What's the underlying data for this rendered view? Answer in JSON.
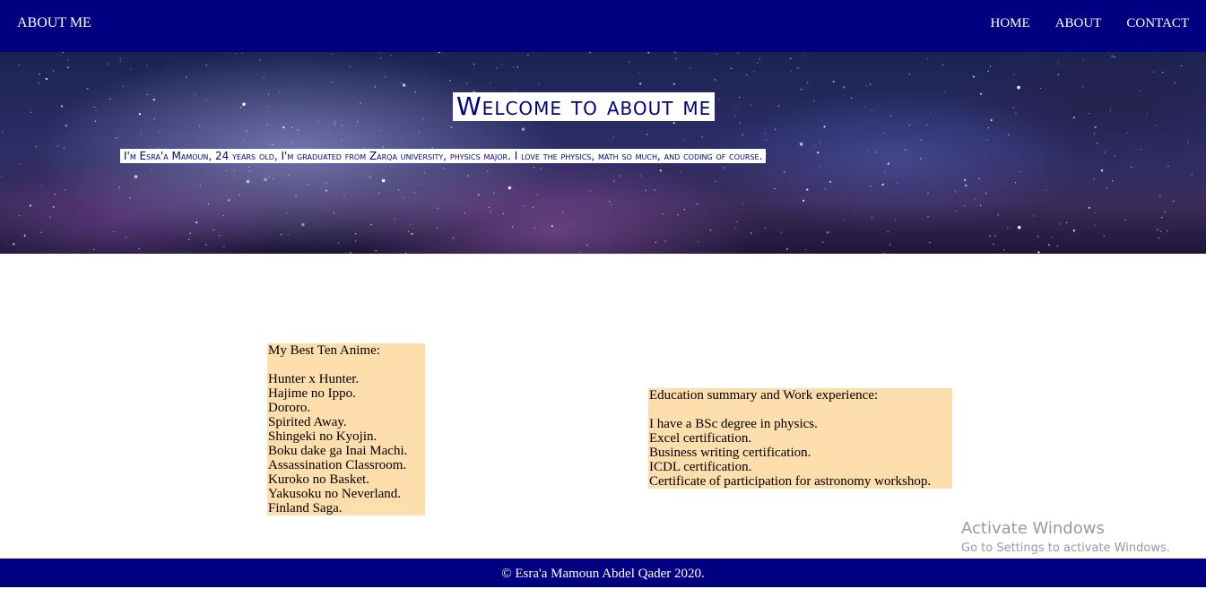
{
  "navbar": {
    "brand": "ABOUT ME",
    "links": [
      "HOME",
      "ABOUT",
      "CONTACT"
    ]
  },
  "hero": {
    "title": "Welcome to about me",
    "subtitle": "I'm Esra'a Mamoun, 24 years old, I'm graduated from Zarqa university, physics major. I love the physics, math so much, and coding of course."
  },
  "anime": {
    "heading": "My Best Ten Anime:",
    "items": [
      "Hunter x Hunter.",
      "Hajime no Ippo.",
      "Dororo.",
      "Spirited Away.",
      "Shingeki no Kyojin.",
      "Boku dake ga Inai Machi.",
      "Assassination Classroom.",
      "Kuroko no Basket.",
      "Yakusoku no Neverland.",
      "Finland Saga."
    ]
  },
  "education": {
    "heading": "Education summary and Work experience:",
    "items": [
      "I have a BSc degree in physics.",
      "Excel certification.",
      "Business writing certification.",
      "ICDL certification.",
      "Certificate of participation for astronomy workshop."
    ]
  },
  "watermark": {
    "title": "Activate Windows",
    "subtitle": "Go to Settings to activate Windows."
  },
  "footer": {
    "text": "© Esra'a Mamoun Abdel Qader 2020."
  },
  "colors": {
    "navy": "#000080",
    "box_background": "#ffdead",
    "white": "#ffffff"
  }
}
